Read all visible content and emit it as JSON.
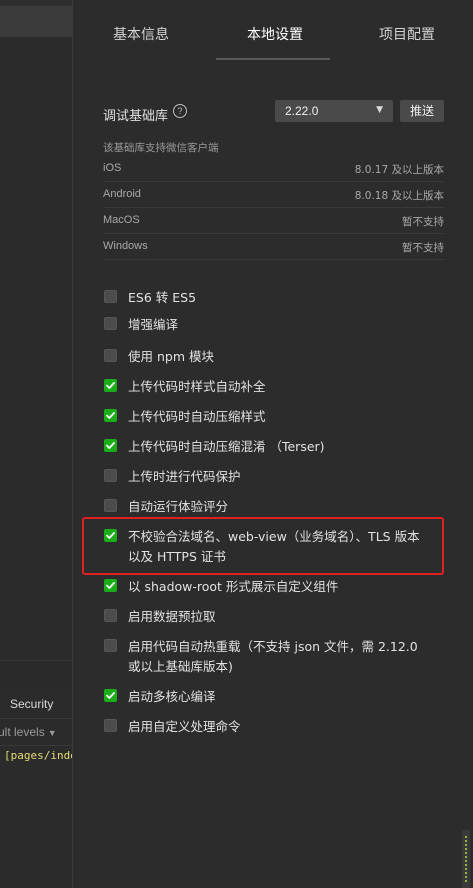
{
  "tabs": [
    {
      "label": "基本信息"
    },
    {
      "label": "本地设置"
    },
    {
      "label": "项目配置"
    }
  ],
  "base_library": {
    "label": "调试基础库",
    "help_icon": "?",
    "selected_version": "2.22.0",
    "push_button": "推送"
  },
  "support_note": "该基础库支持微信客户端",
  "platforms": [
    {
      "name": "iOS",
      "value": "8.0.17 及以上版本"
    },
    {
      "name": "Android",
      "value": "8.0.18 及以上版本"
    },
    {
      "name": "MacOS",
      "value": "暂不支持"
    },
    {
      "name": "Windows",
      "value": "暂不支持"
    }
  ],
  "options": [
    {
      "label": "ES6 转 ES5",
      "checked": false
    },
    {
      "label": "增强编译",
      "checked": false
    },
    {
      "label": "使用 npm 模块",
      "checked": false
    },
    {
      "label": "上传代码时样式自动补全",
      "checked": true
    },
    {
      "label": "上传代码时自动压缩样式",
      "checked": true
    },
    {
      "label": "上传代码时自动压缩混淆 （Terser)",
      "checked": true
    },
    {
      "label": "上传时进行代码保护",
      "checked": false
    },
    {
      "label": "自动运行体验评分",
      "checked": false
    },
    {
      "label": "不校验合法域名、web-view（业务域名）、TLS 版本以及 HTTPS 证书",
      "checked": true
    },
    {
      "label": "以 shadow-root 形式展示自定义组件",
      "checked": true
    },
    {
      "label": "启用数据预拉取",
      "checked": false
    },
    {
      "label": "启用代码自动热重载（不支持 json 文件，需 2.12.0 或以上基础库版本)",
      "checked": false
    },
    {
      "label": "启动多核心编译",
      "checked": true
    },
    {
      "label": "启用自定义处理命令",
      "checked": false
    }
  ],
  "devtools": {
    "security_tab": "Security",
    "levels_label": "ult levels",
    "log_line": "[pages/inde"
  },
  "colors": {
    "accent_check": "#1aad19",
    "highlight": "#e02020"
  }
}
